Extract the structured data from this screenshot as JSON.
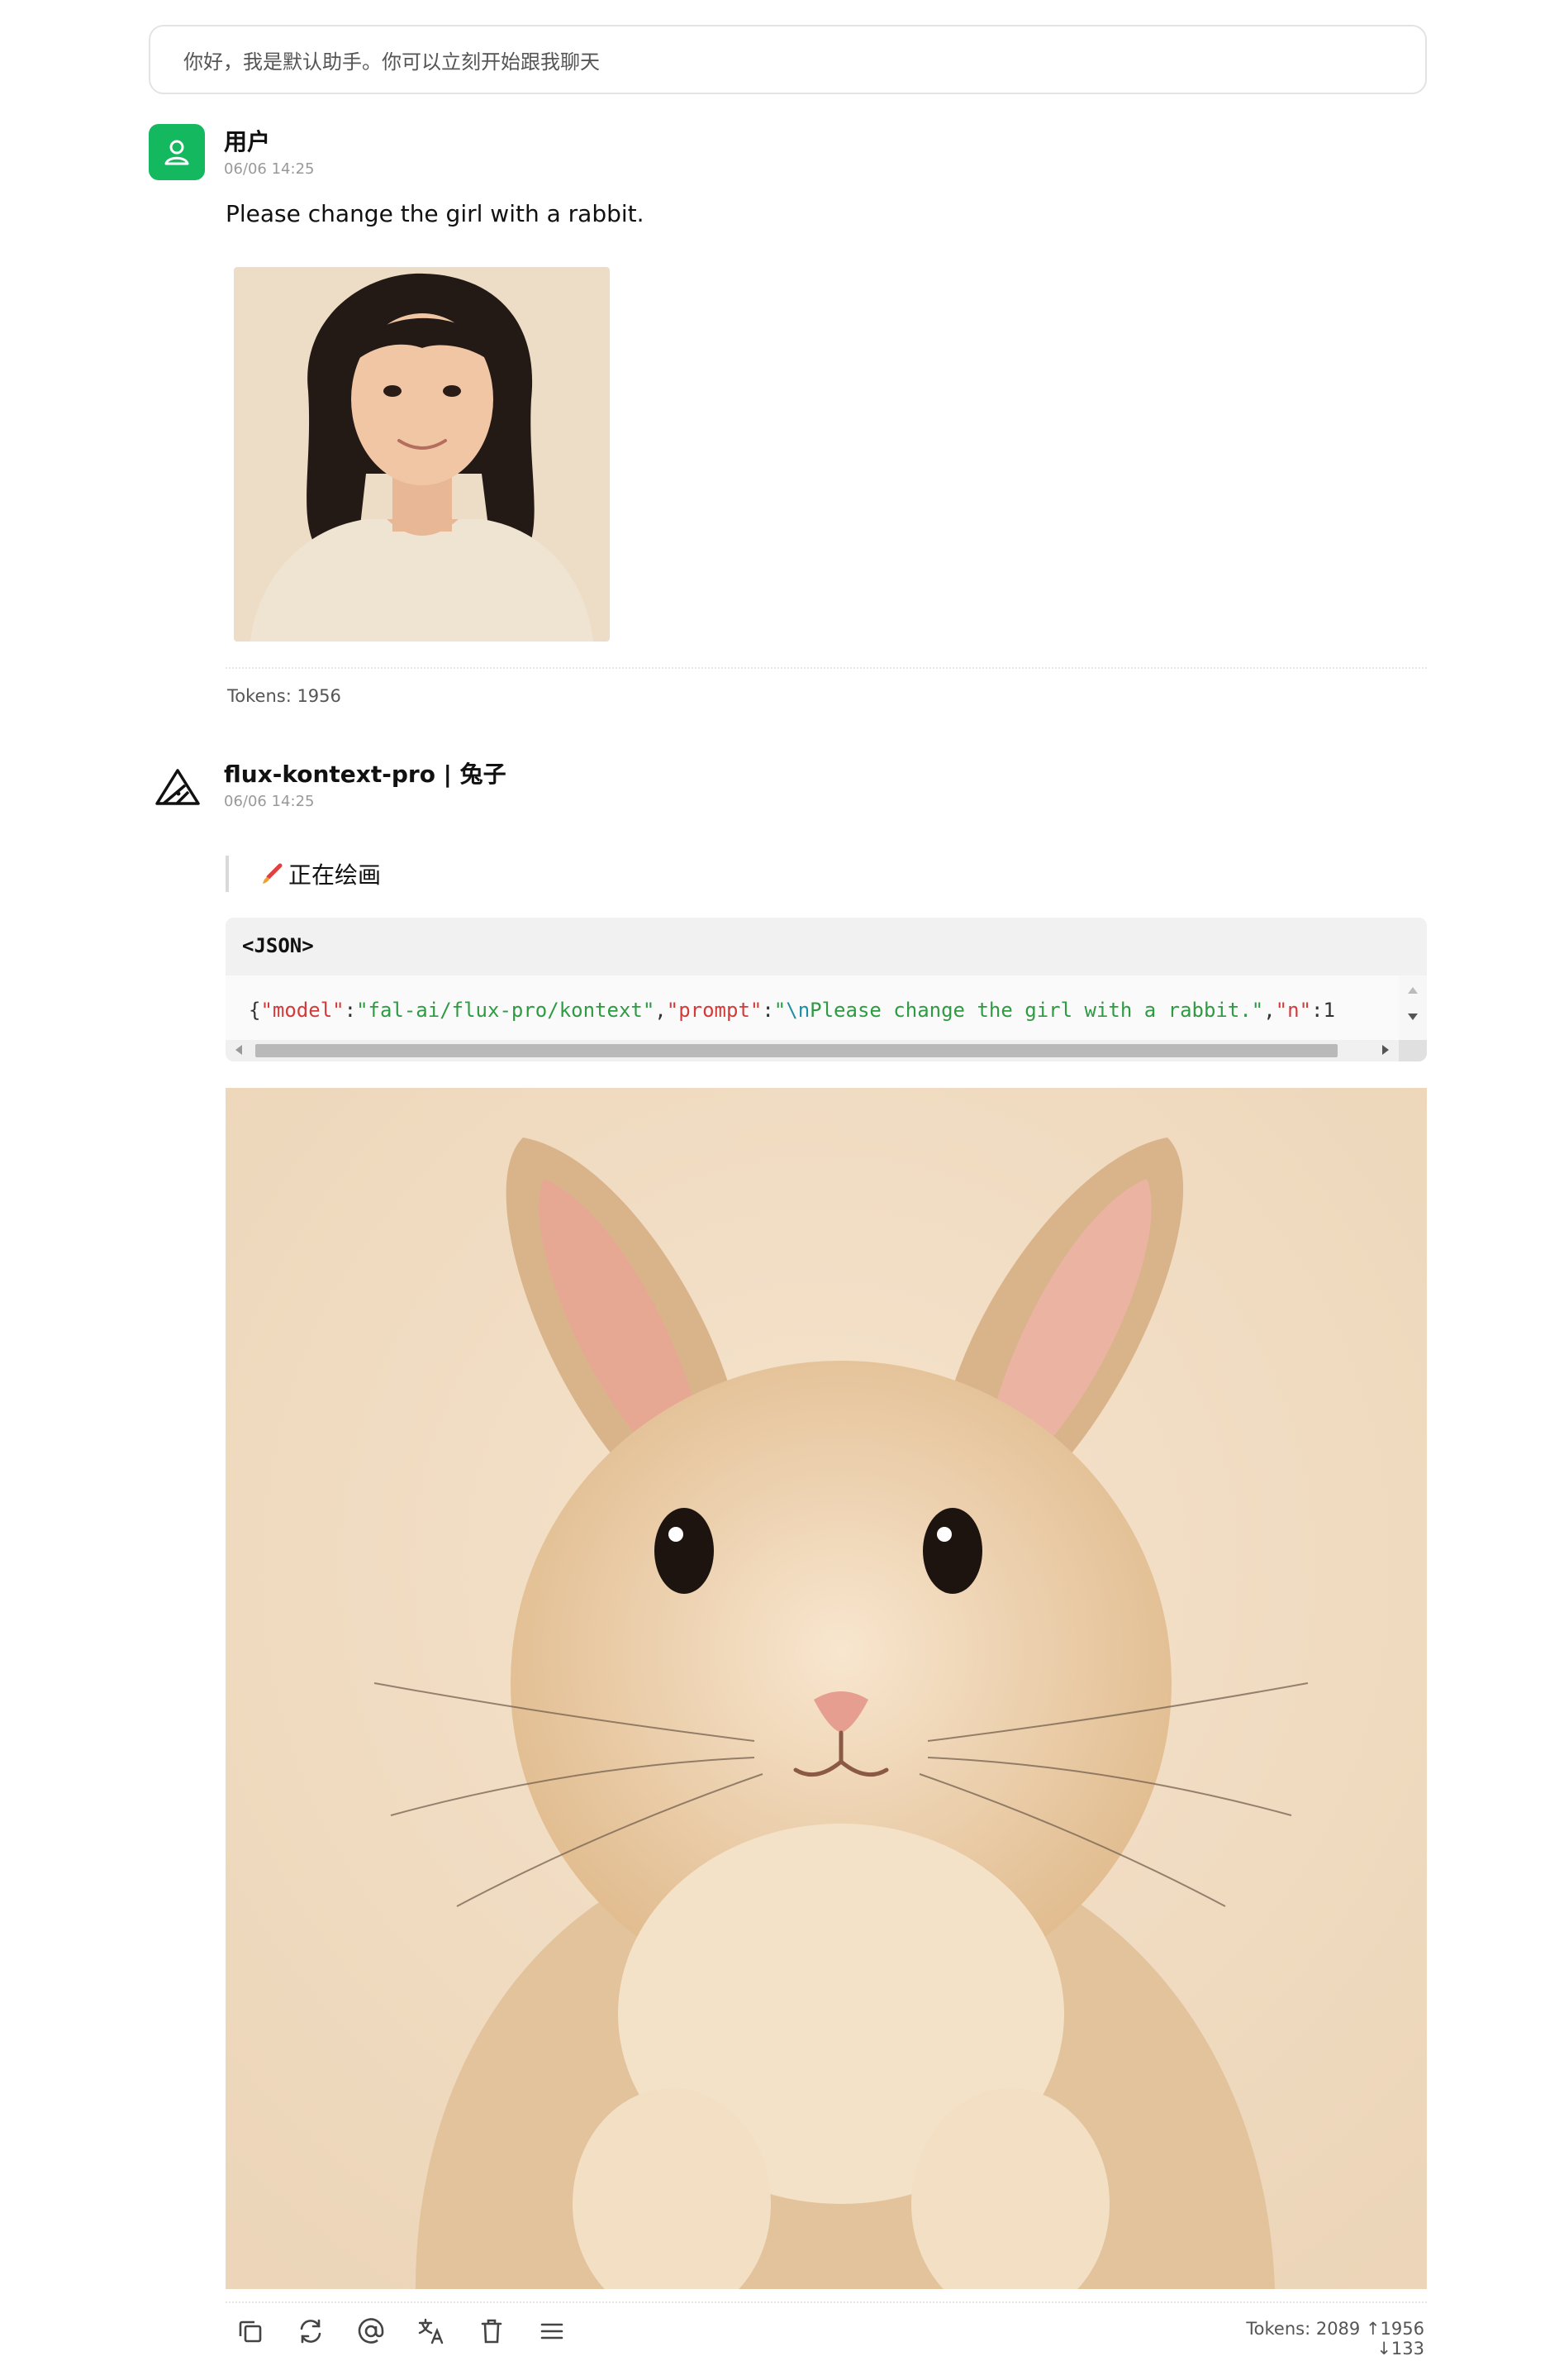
{
  "greeting": {
    "placeholder_text": "你好，我是默认助手。你可以立刻开始跟我聊天"
  },
  "user_message": {
    "author": "用户",
    "time": "06/06 14:25",
    "text": "Please change the girl with a rabbit.",
    "attachment_alt": "portrait photo of a smiling girl",
    "tokens": "Tokens: 1956"
  },
  "bot_message": {
    "author": "flux-kontext-pro | 兔子",
    "time": "06/06 14:25",
    "status_text": "正在绘画",
    "code_block": {
      "header": "<JSON>",
      "tokens": [
        {
          "text": "{",
          "kind": "p"
        },
        {
          "text": "\"model\"",
          "kind": "k"
        },
        {
          "text": ":",
          "kind": "p"
        },
        {
          "text": "\"fal-ai/flux-pro/kontext\"",
          "kind": "s"
        },
        {
          "text": ",",
          "kind": "p"
        },
        {
          "text": "\"prompt\"",
          "kind": "k"
        },
        {
          "text": ":",
          "kind": "p"
        },
        {
          "text": "\"",
          "kind": "s"
        },
        {
          "text": "\\n",
          "kind": "e"
        },
        {
          "text": "Please change the girl with a rabbit.\"",
          "kind": "s"
        },
        {
          "text": ",",
          "kind": "p"
        },
        {
          "text": "\"n\"",
          "kind": "k"
        },
        {
          "text": ":1",
          "kind": "p"
        }
      ]
    },
    "result_alt": "generated image of a fluffy rabbit",
    "footer_tokens": "Tokens: 2089 ↑1956 ↓133"
  },
  "actions": [
    "copy",
    "regenerate",
    "mention",
    "translate",
    "delete",
    "more"
  ],
  "colors": {
    "accent": "#14b85f",
    "json_key": "#d33a3a",
    "json_string": "#2e9b43",
    "json_escape": "#1d8ea3"
  }
}
